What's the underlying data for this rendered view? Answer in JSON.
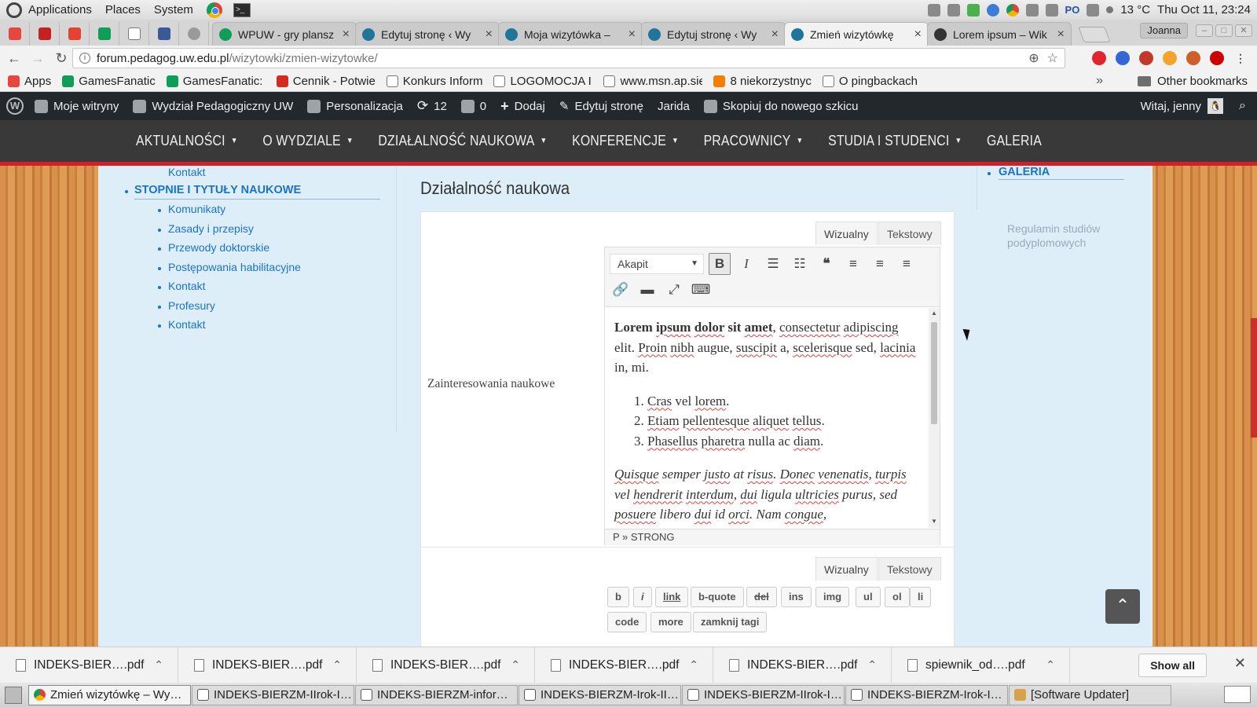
{
  "os_panel": {
    "menus": [
      "Applications",
      "Places",
      "System"
    ],
    "keyboard_layout": "PO",
    "temperature": "13 °C",
    "clock": "Thu Oct 11, 23:24"
  },
  "browser": {
    "tabs": [
      {
        "title": "WPUW - gry plansz",
        "color": "#0f9d58"
      },
      {
        "title": "Edytuj stronę ‹ Wy",
        "color": "#21759b"
      },
      {
        "title": "Moja wizytówka –",
        "color": "#21759b"
      },
      {
        "title": "Edytuj stronę ‹ Wy",
        "color": "#21759b"
      },
      {
        "title": "Zmień wizytówkę",
        "color": "#21759b"
      },
      {
        "title": "Lorem ipsum – Wik",
        "color": "#333333"
      }
    ],
    "profile_name": "Joanna",
    "url_host": "forum.pedagog.uw.edu.pl",
    "url_path": "/wizytowki/zmien-wizytowke/",
    "bookmarks": [
      {
        "label": "Apps",
        "color": "#e8453c"
      },
      {
        "label": "GamesFanatic",
        "color": "#0f9d58"
      },
      {
        "label": "GamesFanatic: C",
        "color": "#0f9d58"
      },
      {
        "label": "Cennik - Potwie",
        "color": "#d52b1e"
      },
      {
        "label": "Konkurs Inform",
        "color": "#ffffff"
      },
      {
        "label": "LOGOMOCJA IN",
        "color": "#ffffff"
      },
      {
        "label": "www.msn.ap.sie",
        "color": "#ffffff"
      },
      {
        "label": "8 niekorzystnyc",
        "color": "#f57d00"
      },
      {
        "label": "O pingbackach i",
        "color": "#ffffff"
      }
    ],
    "bookmarks_more": "»",
    "other_bookmarks": "Other bookmarks"
  },
  "wp_admin_bar": {
    "items": [
      {
        "label": "Moje witryny"
      },
      {
        "label": "Wydział Pedagogiczny UW"
      },
      {
        "label": "Personalizacja"
      },
      {
        "label": "12"
      },
      {
        "label": "0"
      },
      {
        "label": "Dodaj"
      },
      {
        "label": "Edytuj stronę"
      },
      {
        "label": "Jarida"
      },
      {
        "label": "Skopiuj do nowego szkicu"
      }
    ],
    "greeting": "Witaj, jenny"
  },
  "site_nav": [
    "AKTUALNOŚCI",
    "O WYDZIALE",
    "DZIAŁALNOŚĆ NAUKOWA",
    "KONFERENCJE",
    "PRACOWNICY",
    "STUDIA I STUDENCI",
    "GALERIA"
  ],
  "sidebar_left": {
    "top_link": "Kontakt",
    "heading": "STOPNIE I TYTUŁY NAUKOWE",
    "items": [
      "Komunikaty",
      "Zasady i przepisy",
      "Przewody doktorskie",
      "Postępowania habilitacyjne",
      "Kontakt",
      "Profesury",
      "Kontakt"
    ]
  },
  "sidebar_right": {
    "ghost_text": "Regulamin studiów podyplomowych",
    "galeria": "GALERIA"
  },
  "content": {
    "title": "Działalność naukowa",
    "field_label": "Zainteresowania naukowe",
    "mode_visual": "Wizualny",
    "mode_text": "Tekstowy",
    "format_select": "Akapit",
    "status_path": "P » STRONG",
    "quicktags": [
      "b",
      "i",
      "link",
      "b-quote",
      "del",
      "ins",
      "img",
      "ul",
      "ol",
      "li",
      "code",
      "more",
      "zamknij tagi"
    ]
  },
  "downloads": [
    "INDEKS-BIER….pdf",
    "INDEKS-BIER….pdf",
    "INDEKS-BIER….pdf",
    "INDEKS-BIER….pdf",
    "INDEKS-BIER….pdf",
    "spiewnik_od….pdf"
  ],
  "downloads_show_all": "Show all",
  "taskbar": [
    {
      "label": "Zmień wizytówkę – Wy…",
      "active": true
    },
    {
      "label": "INDEKS-BIERZM-IIrok-I…",
      "active": false
    },
    {
      "label": "INDEKS-BIERZM-infor…",
      "active": false
    },
    {
      "label": "INDEKS-BIERZM-Irok-II…",
      "active": false
    },
    {
      "label": "INDEKS-BIERZM-IIrok-I…",
      "active": false
    },
    {
      "label": "INDEKS-BIERZM-Irok-I…",
      "active": false
    },
    {
      "label": "[Software Updater]",
      "active": false
    }
  ]
}
